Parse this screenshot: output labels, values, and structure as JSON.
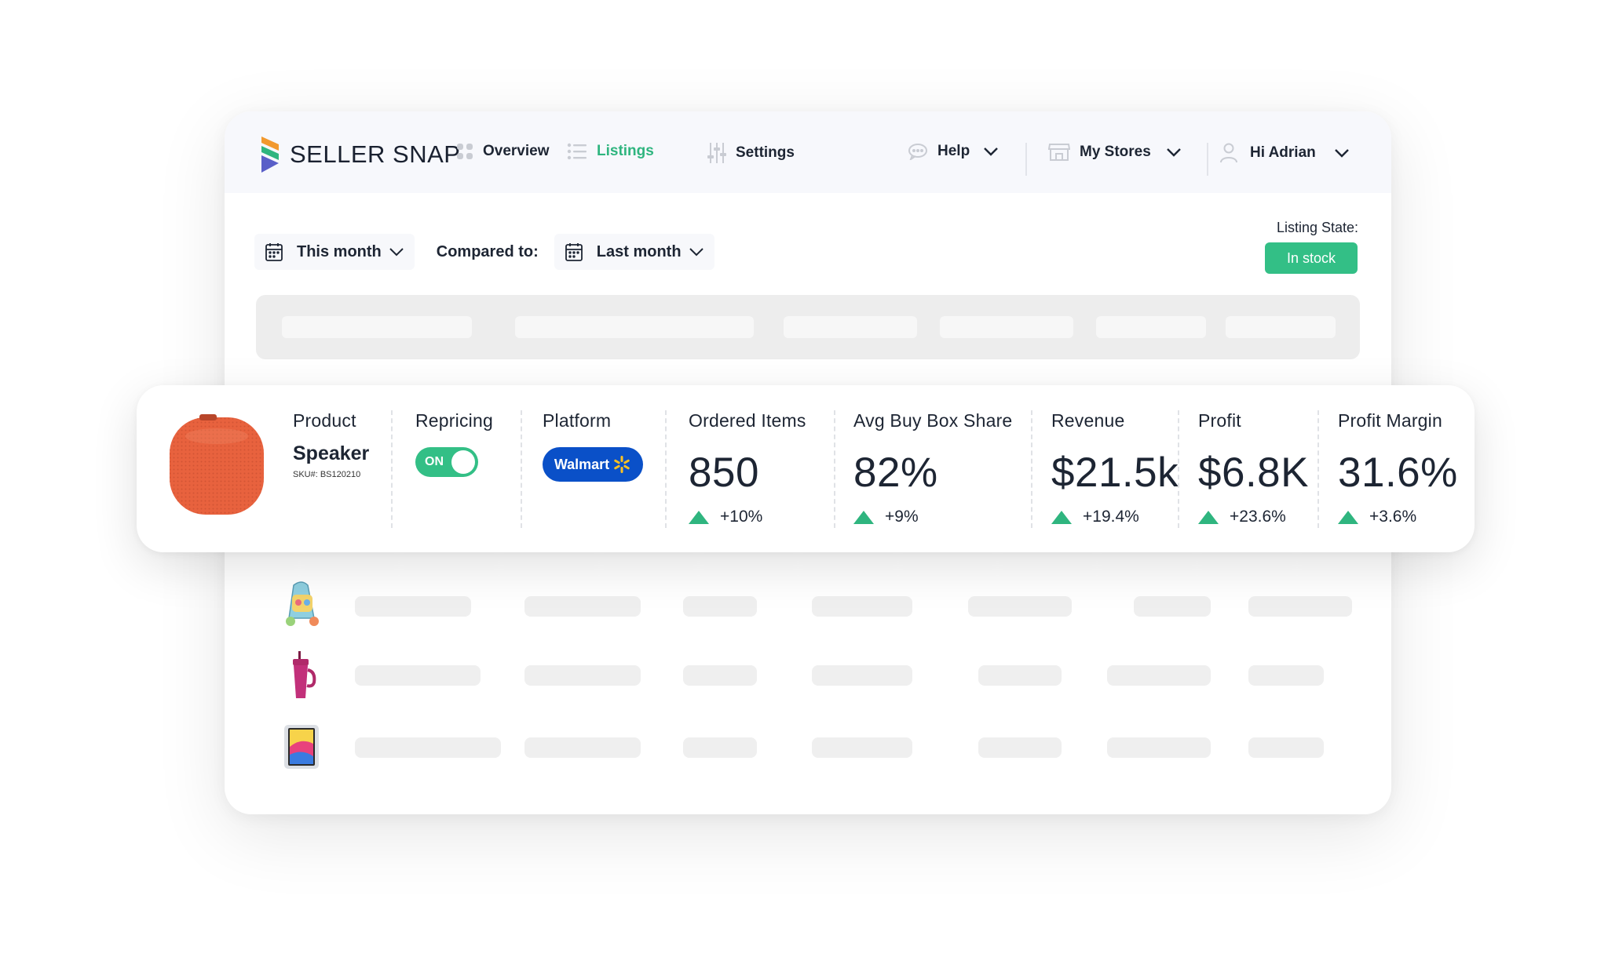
{
  "brand": {
    "name": "SELLER SNAP"
  },
  "nav": {
    "overview": "Overview",
    "listings": "Listings",
    "settings": "Settings",
    "help": "Help",
    "stores": "My Stores",
    "user": "Hi Adrian"
  },
  "filters": {
    "current_period": "This month",
    "compared_label": "Compared to:",
    "compare_period": "Last month"
  },
  "listing_state": {
    "label": "Listing State:",
    "value": "In stock"
  },
  "product_card": {
    "product_header": "Product",
    "product_name": "Speaker",
    "sku": "SKU#: BS120210",
    "repricing_header": "Repricing",
    "repricing_state": "ON",
    "platform_header": "Platform",
    "platform_name": "Walmart",
    "metrics": [
      {
        "label": "Ordered Items",
        "value": "850",
        "change": "+10%"
      },
      {
        "label": "Avg Buy Box Share",
        "value": "82%",
        "change": "+9%"
      },
      {
        "label": "Revenue",
        "value": "$21.5k",
        "change": "+19.4%"
      },
      {
        "label": "Profit",
        "value": "$6.8K",
        "change": "+23.6%"
      },
      {
        "label": "Profit Margin",
        "value": "31.6%",
        "change": "+3.6%"
      }
    ]
  },
  "colors": {
    "accent": "#2fb57f",
    "badge": "#33bf86",
    "walmart": "#0a50c8",
    "speaker": "#e8623e"
  },
  "icons": [
    "logo-icon",
    "grid-icon",
    "list-icon",
    "sliders-icon",
    "chat-icon",
    "store-icon",
    "user-icon",
    "chevron-down-icon",
    "calendar-icon",
    "trend-up-icon",
    "walmart-spark-icon"
  ]
}
